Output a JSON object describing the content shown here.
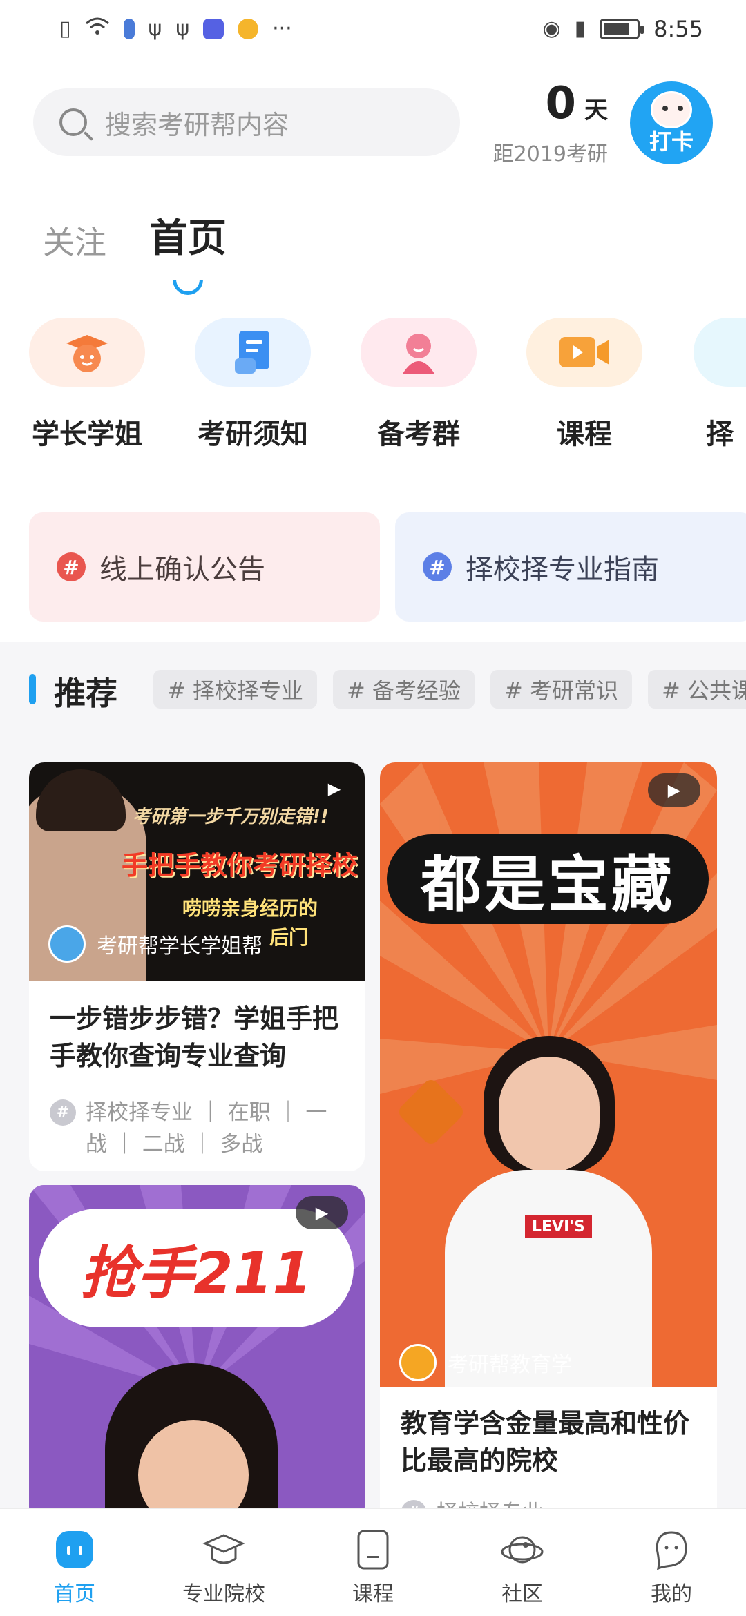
{
  "status_bar": {
    "time": "8:55",
    "left_icons": [
      "sim-alert-icon",
      "wifi-icon",
      "battery-saver-icon",
      "usb-icon",
      "usb-icon",
      "music-app-icon",
      "weibo-icon",
      "more-dots-icon"
    ],
    "right_icons": [
      "eye-comfort-icon",
      "vibrate-icon",
      "battery-icon"
    ],
    "battery_level": 0.8
  },
  "header": {
    "search_placeholder": "搜索考研帮内容",
    "countdown_number": "0",
    "countdown_unit": "天",
    "countdown_label": "距2019考研",
    "punch_label": "打卡"
  },
  "tabs": [
    {
      "label": "关注",
      "active": false
    },
    {
      "label": "首页",
      "active": true
    }
  ],
  "quick_entries": [
    {
      "label": "学长学姐",
      "icon": "graduation-cap-icon",
      "bg": "#ffeee6",
      "color": "#f47a3a"
    },
    {
      "label": "考研须知",
      "icon": "document-icon",
      "bg": "#e8f3ff",
      "color": "#3b8ff2"
    },
    {
      "label": "备考群",
      "icon": "group-person-icon",
      "bg": "#ffe9ee",
      "color": "#f06a86"
    },
    {
      "label": "课程",
      "icon": "video-camera-icon",
      "bg": "#fff0df",
      "color": "#f59a2a"
    },
    {
      "label": "择",
      "icon": "partial-entry-icon",
      "bg": "#e6f7fd",
      "color": "#37b7ea"
    }
  ],
  "topics": [
    {
      "label": "线上确认公告",
      "color": "#e9564f",
      "bg": "#fdeced",
      "text_color": "#4b3d3d"
    },
    {
      "label": "择校择专业指南",
      "color": "#5c7fe6",
      "bg": "#edf2fc",
      "text_color": "#3c4257"
    }
  ],
  "recommend": {
    "title": "推荐",
    "tags": [
      "# 择校择专业",
      "# 备考经验",
      "# 考研常识",
      "# 公共课"
    ]
  },
  "cards": [
    {
      "thumb_lines": [
        "考研第一步千万别走错!!",
        "手把手教你考研择校",
        "唠唠亲身经历的",
        "后门"
      ],
      "author": "考研帮学长学姐帮",
      "title": "一步错步步错？学姐手把手教你查询专业查询",
      "tags": "择校择专业 ｜ 在职 ｜ 一战 ｜ 二战 ｜ 多战"
    },
    {
      "thumb_text": "都是宝藏",
      "shirt_text": "LEVI'S",
      "author": "考研帮教育学",
      "title": "教育学含金量最高和性价比最高的院校",
      "tags": "择校择专业"
    },
    {
      "thumb_text": "抢手211"
    }
  ],
  "bottom_nav": [
    {
      "label": "首页",
      "icon": "home-icon",
      "active": true
    },
    {
      "label": "专业院校",
      "icon": "graduation-hat-icon",
      "active": false
    },
    {
      "label": "课程",
      "icon": "course-book-icon",
      "active": false
    },
    {
      "label": "社区",
      "icon": "community-planet-icon",
      "active": false
    },
    {
      "label": "我的",
      "icon": "profile-icon",
      "active": false
    }
  ],
  "colors": {
    "accent": "#1fa0f0",
    "orange_card": "#ee6a33",
    "purple_card": "#8b59c1"
  }
}
